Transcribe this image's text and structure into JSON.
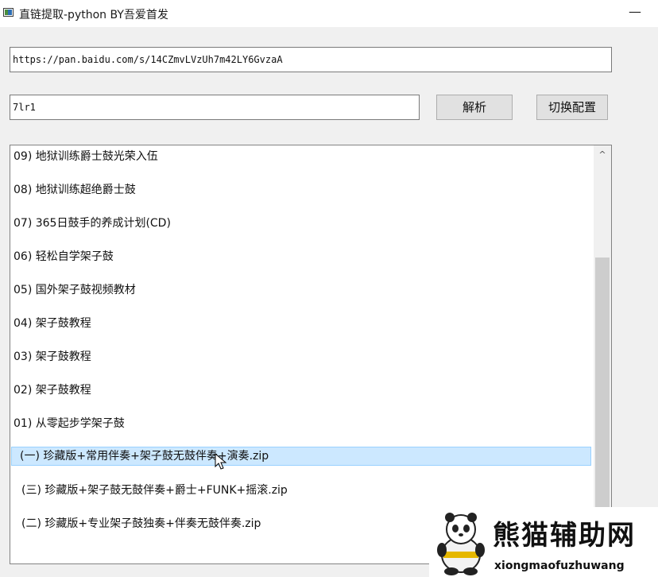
{
  "window": {
    "title": "直链提取-python BY吾爱首发",
    "minimize_label": "—"
  },
  "form": {
    "url_value": "https://pan.baidu.com/s/14CZmvLVzUh7m42LY6GvzaA",
    "password_value": "7lr1",
    "parse_label": "解析",
    "switch_label": "切换配置"
  },
  "list": {
    "items": [
      "09) 地狱训练爵士鼓光荣入伍",
      "08) 地狱训练超绝爵士鼓",
      "07) 365日鼓手的养成计划(CD)",
      "06) 轻松自学架子鼓",
      "05) 国外架子鼓视频教材",
      "04) 架子鼓教程",
      "03) 架子鼓教程",
      "02) 架子鼓教程",
      "01) 从零起步学架子鼓",
      "(一) 珍藏版+常用伴奏+架子鼓无鼓伴奏+演奏.zip",
      "(三) 珍藏版+架子鼓无鼓伴奏+爵士+FUNK+摇滚.zip",
      "(二) 珍藏版+专业架子鼓独奏+伴奏无鼓伴奏.zip"
    ],
    "selected_index": 9,
    "scroll_up_glyph": "^"
  },
  "watermark": {
    "cn_text": "熊猫辅助网",
    "en_text": "xiongmaofuzhuwang"
  },
  "colors": {
    "selection_bg": "#cce8ff",
    "selection_border": "#99d1ff",
    "window_bg": "#f0f0f0"
  }
}
